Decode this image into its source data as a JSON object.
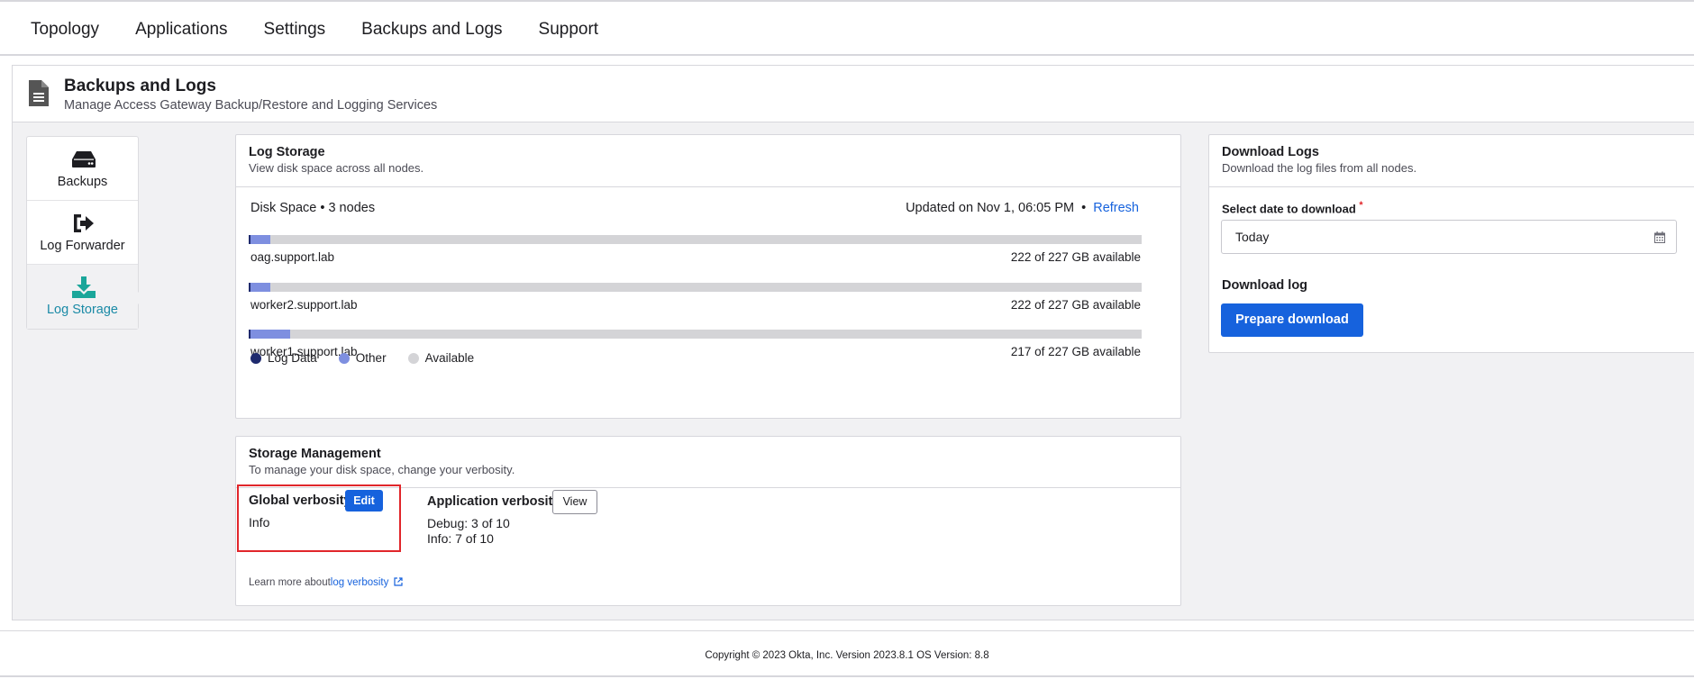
{
  "nav": {
    "items": [
      "Topology",
      "Applications",
      "Settings",
      "Backups and Logs",
      "Support"
    ]
  },
  "header": {
    "icon": "document-icon",
    "title": "Backups and Logs",
    "subtitle": "Manage Access Gateway Backup/Restore and Logging Services"
  },
  "sidebar": {
    "items": [
      {
        "label": "Backups",
        "icon": "hard-drive-icon",
        "active": false
      },
      {
        "label": "Log Forwarder",
        "icon": "sign-out-icon",
        "active": false
      },
      {
        "label": "Log Storage",
        "icon": "download-icon",
        "active": true
      }
    ]
  },
  "log_storage": {
    "title": "Log Storage",
    "subtitle": "View disk space across all nodes.",
    "disk_label": "Disk Space • 3 nodes",
    "updated": "Updated on Nov 1, 06:05 PM",
    "separator": "•",
    "refresh": "Refresh",
    "nodes": [
      {
        "name": "oag.support.lab",
        "available": "222 of 227 GB available",
        "log_fraction": 0.002,
        "other_fraction": 0.022
      },
      {
        "name": "worker2.support.lab",
        "available": "222 of 227 GB available",
        "log_fraction": 0.002,
        "other_fraction": 0.022
      },
      {
        "name": "worker1.support.lab",
        "available": "217 of 227 GB available",
        "log_fraction": 0.002,
        "other_fraction": 0.044
      }
    ],
    "legend": [
      {
        "label": "Log Data",
        "color": "#1e2a6e"
      },
      {
        "label": "Other",
        "color": "#7e8fe0"
      },
      {
        "label": "Available",
        "color": "#d4d4d7"
      }
    ]
  },
  "storage_management": {
    "title": "Storage Management",
    "subtitle": "To manage your disk space, change your verbosity.",
    "global_title": "Global verbosity",
    "edit_label": "Edit",
    "global_value": "Info",
    "app_title": "Application verbosity",
    "view_label": "View",
    "debug_line": "Debug: 3 of 10",
    "info_line": "Info: 7 of 10",
    "learn_prefix": "Learn more about",
    "learn_link": "log verbosity"
  },
  "download": {
    "title": "Download Logs",
    "subtitle": "Download the log files from all nodes.",
    "date_label": "Select date to download",
    "required_mark": "*",
    "date_value": "Today",
    "section_label": "Download log",
    "button_label": "Prepare download"
  },
  "footer": {
    "copyright": "Copyright © 2023 Okta, Inc. Version 2023.8.1 OS Version: 8.8"
  },
  "colors": {
    "accent": "#1662dd",
    "active_nav": "#1a8aa6",
    "highlight_box": "#e1262b"
  }
}
